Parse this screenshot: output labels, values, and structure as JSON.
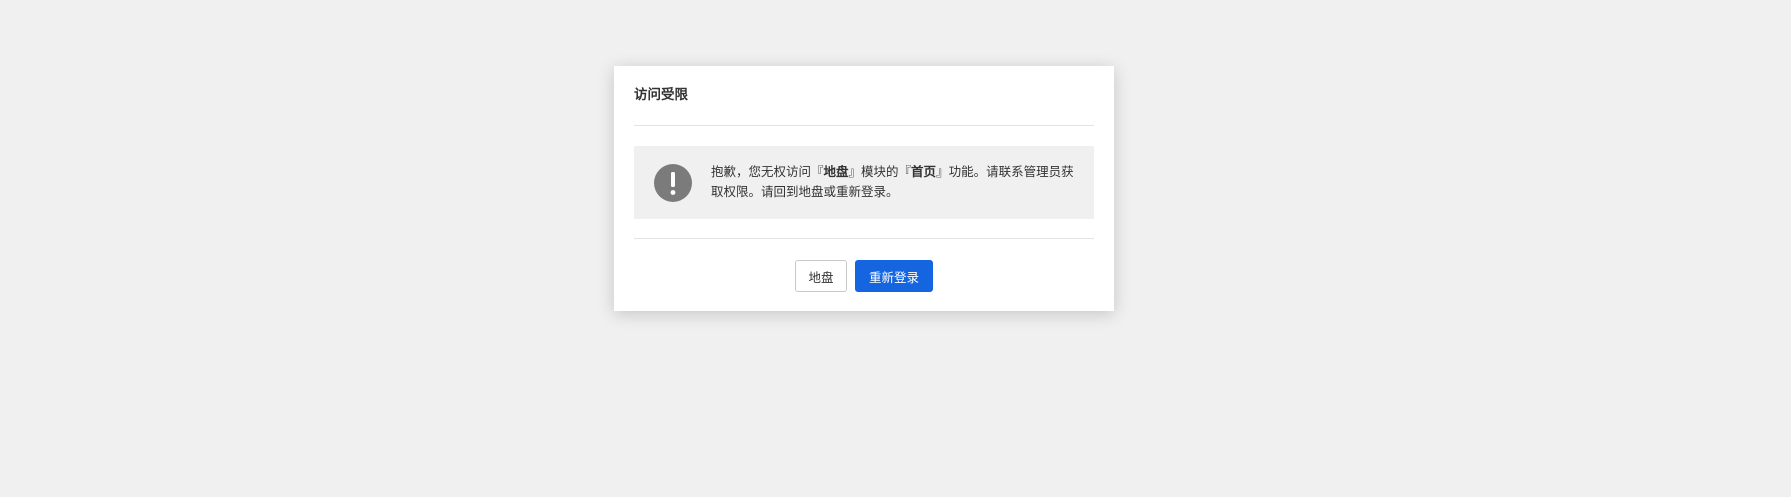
{
  "dialog": {
    "title": "访问受限",
    "message": {
      "part1": "抱歉，您无权访问『",
      "module": "地盘",
      "part2": "』模块的『",
      "page": "首页",
      "part3": "』功能。请联系管理员获取权限。请回到地盘或重新登录。"
    },
    "icon": "exclamation-circle-icon",
    "buttons": {
      "home_label": "地盘",
      "relogin_label": "重新登录"
    }
  },
  "colors": {
    "background": "#f0f0f0",
    "primary": "#1565e0",
    "icon": "#7b7b7b"
  }
}
